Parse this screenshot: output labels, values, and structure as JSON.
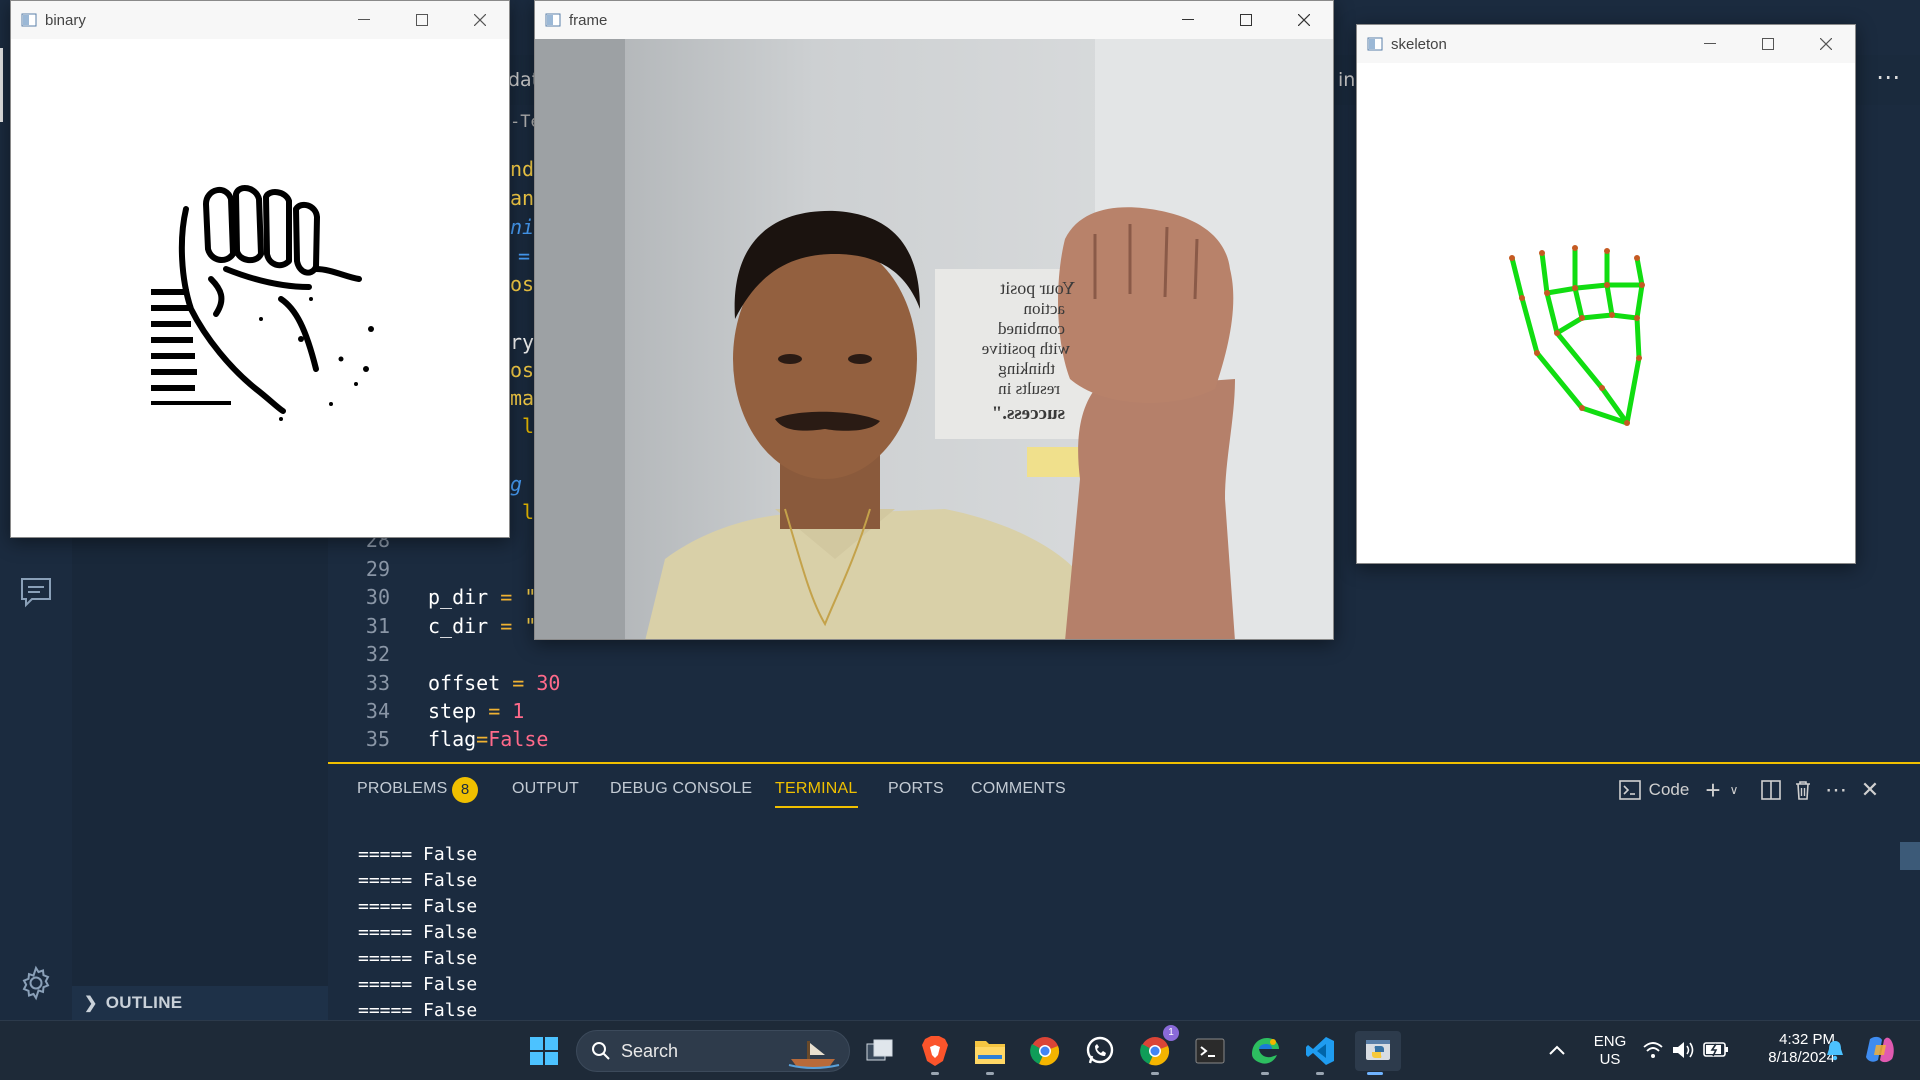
{
  "editor": {
    "tab_partial_left": "dat",
    "tab_partial_right": "in",
    "breadcrumb_partial": "-Te",
    "peek_fragments": [
      "nd",
      "an",
      "ni",
      "=",
      "os",
      "ry",
      "os",
      "ma",
      "l",
      "g",
      "l"
    ],
    "lines": [
      {
        "num": "28",
        "tokens": []
      },
      {
        "num": "29",
        "tokens": []
      },
      {
        "num": "30",
        "tokens": [
          {
            "t": "id",
            "v": "p_dir"
          },
          {
            "t": "op",
            "v": " = "
          },
          {
            "t": "str",
            "v": "\""
          }
        ]
      },
      {
        "num": "31",
        "tokens": [
          {
            "t": "id",
            "v": "c_dir"
          },
          {
            "t": "op",
            "v": " = "
          },
          {
            "t": "str",
            "v": "\""
          }
        ]
      },
      {
        "num": "32",
        "tokens": []
      },
      {
        "num": "33",
        "tokens": [
          {
            "t": "id",
            "v": "offset"
          },
          {
            "t": "op",
            "v": " = "
          },
          {
            "t": "num",
            "v": "30"
          }
        ]
      },
      {
        "num": "34",
        "tokens": [
          {
            "t": "id",
            "v": "step"
          },
          {
            "t": "op",
            "v": " = "
          },
          {
            "t": "num",
            "v": "1"
          }
        ]
      },
      {
        "num": "35",
        "tokens": [
          {
            "t": "id",
            "v": "flag"
          },
          {
            "t": "op",
            "v": "="
          },
          {
            "t": "kw",
            "v": "False"
          }
        ]
      }
    ]
  },
  "sidebar": {
    "outline_label": "OUTLINE"
  },
  "panel": {
    "tabs": [
      {
        "label": "PROBLEMS",
        "active": false
      },
      {
        "label": "OUTPUT",
        "active": false
      },
      {
        "label": "DEBUG CONSOLE",
        "active": false
      },
      {
        "label": "TERMINAL",
        "active": true
      },
      {
        "label": "PORTS",
        "active": false
      },
      {
        "label": "COMMENTS",
        "active": false
      }
    ],
    "problems_count": "8",
    "terminal_name": "Code",
    "terminal_lines": [
      "===== False",
      "===== False",
      "===== False",
      "===== False",
      "===== False",
      "===== False",
      "===== False"
    ]
  },
  "windows": {
    "binary": {
      "title": "binary"
    },
    "frame": {
      "title": "frame",
      "sign_lines": [
        "Your posit",
        "action",
        "combined",
        "with positive",
        "thinking",
        "results in",
        "success.\""
      ]
    },
    "skeleton": {
      "title": "skeleton"
    }
  },
  "taskbar": {
    "search_placeholder": "Search",
    "lang": "ENG",
    "region": "US",
    "time": "4:32 PM",
    "date": "8/18/2024",
    "chrome_badge": "1",
    "icons": [
      "windows-start-icon",
      "search-icon",
      "task-view-icon",
      "brave-icon",
      "file-explorer-icon",
      "chrome-icon",
      "whatsapp-icon",
      "chrome-profile-icon",
      "terminal-icon",
      "edge-dev-icon",
      "vscode-icon",
      "python-icon"
    ]
  },
  "colors": {
    "accent": "#f0c000",
    "editor_bg": "#1b2b3f",
    "skeleton_green": "#11dd11"
  }
}
